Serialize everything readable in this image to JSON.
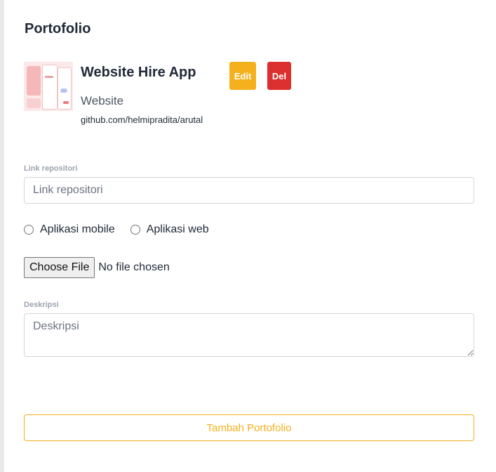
{
  "page": {
    "title": "Portofolio"
  },
  "portfolio_item": {
    "name": "Website Hire App",
    "type": "Website",
    "link": "github.com/helmipradita/arutal",
    "edit_label": "Edit",
    "delete_label": "Del",
    "thumbnail_icon": "app-screens-thumbnail"
  },
  "form": {
    "repo_label": "Link repositori",
    "repo_placeholder": "Link repositori",
    "repo_value": "",
    "radio_options": [
      {
        "label": "Aplikasi mobile",
        "checked": false
      },
      {
        "label": "Aplikasi web",
        "checked": false
      }
    ],
    "file_button_label": "Choose File",
    "file_status": "No file chosen",
    "desc_label": "Deskripsi",
    "desc_placeholder": "Deskripsi",
    "desc_value": "",
    "submit_label": "Tambah Portofolio"
  },
  "colors": {
    "accent": "#f5b11d",
    "danger": "#dc2f2f",
    "background": "#ffffff",
    "page_bg": "#e9e9e9"
  }
}
